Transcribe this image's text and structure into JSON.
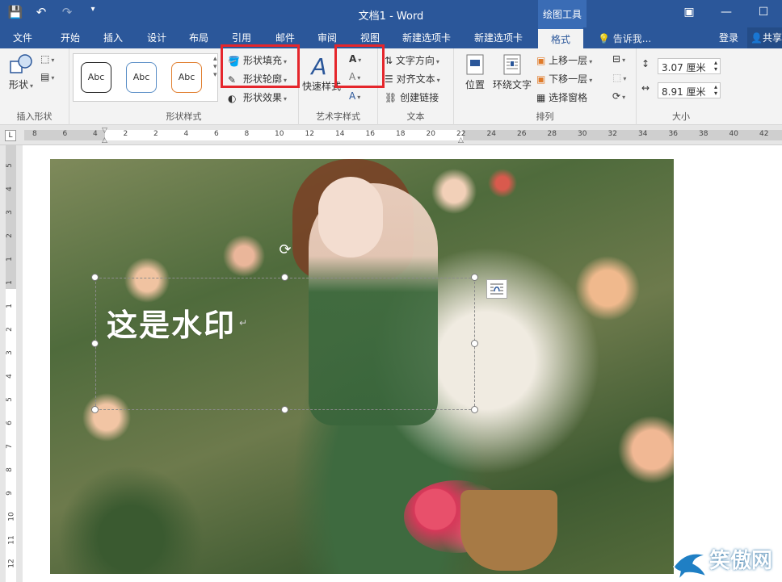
{
  "window": {
    "title": "文档1 - Word",
    "context_header": "绘图工具",
    "qat": [
      "save-icon",
      "undo-icon",
      "redo-icon",
      "customize-icon"
    ]
  },
  "tabs": [
    "文件",
    "开始",
    "插入",
    "设计",
    "布局",
    "引用",
    "邮件",
    "审阅",
    "视图",
    "新建选项卡",
    "新建选项卡",
    "格式"
  ],
  "active_tab": "格式",
  "tell_me": "告诉我...",
  "login": "登录",
  "share": "共享",
  "ribbon": {
    "insert_shapes": {
      "label": "插入形状",
      "shapes_btn": "形状"
    },
    "shape_styles": {
      "label": "形状样式",
      "presets": [
        "Abc",
        "Abc",
        "Abc"
      ],
      "fill": "形状填充",
      "outline": "形状轮廓",
      "effects": "形状效果"
    },
    "wordart": {
      "label": "艺术字样式",
      "quick_styles": "快速样式",
      "text_fill": "A",
      "text_outline": "A",
      "text_effects": "A"
    },
    "text": {
      "label": "文本",
      "direction": "文字方向",
      "align": "对齐文本",
      "link": "创建链接"
    },
    "arrange": {
      "label": "排列",
      "position": "位置",
      "wrap": "环绕文字",
      "forward": "上移一层",
      "backward": "下移一层",
      "selection": "选择窗格"
    },
    "size": {
      "label": "大小",
      "height": "3.07 厘米",
      "width": "8.91 厘米"
    }
  },
  "ruler": {
    "corner": "L",
    "ticks": [
      "8",
      "6",
      "4",
      "2",
      "2",
      "4",
      "6",
      "8",
      "10",
      "12",
      "14",
      "16",
      "18",
      "20",
      "22",
      "24",
      "26",
      "28",
      "30",
      "32",
      "34",
      "36",
      "38",
      "40",
      "42"
    ],
    "vticks": [
      "5",
      "4",
      "3",
      "2",
      "1",
      "1",
      "1",
      "2",
      "3",
      "4",
      "5",
      "6",
      "7",
      "8",
      "9",
      "10",
      "11",
      "12"
    ]
  },
  "document": {
    "watermark_text": "这是水印"
  },
  "logo": {
    "text": "笑傲网",
    "sub": "xajjn.com"
  },
  "colors": {
    "accent": "#2b579a",
    "highlight": "#e5262c"
  }
}
